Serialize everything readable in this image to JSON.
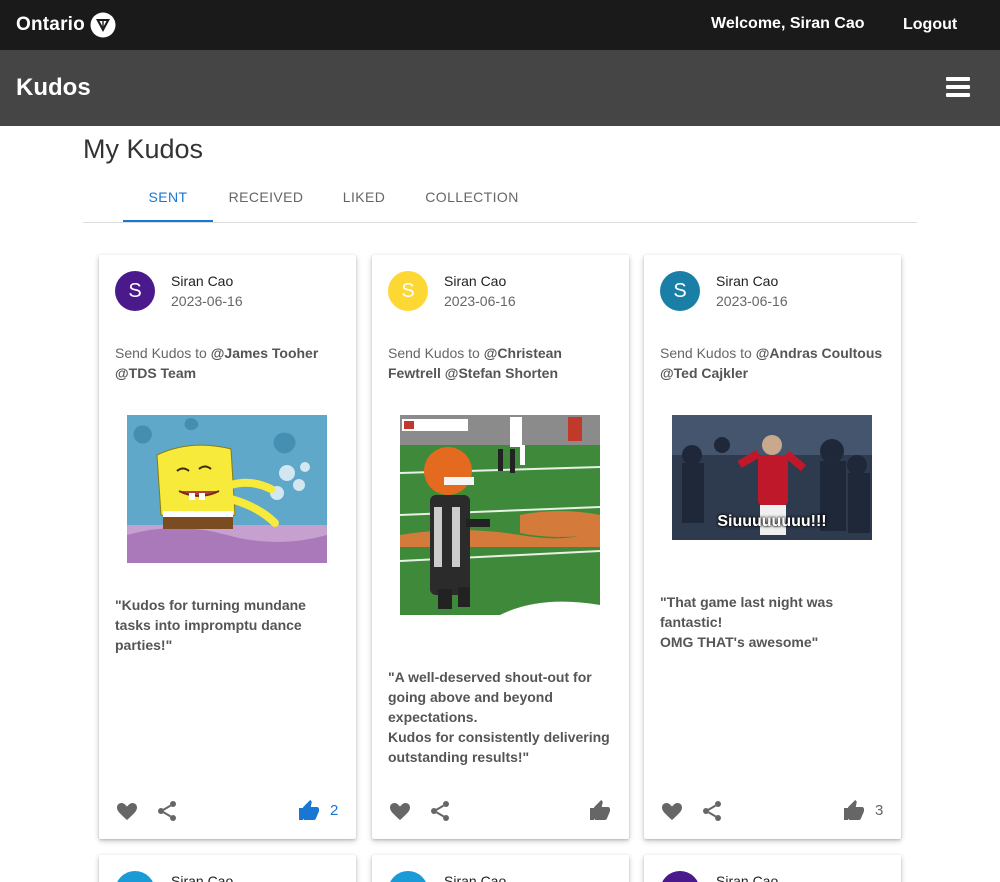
{
  "topbar": {
    "brand": "Ontario",
    "welcome": "Welcome, Siran Cao",
    "logout": "Logout"
  },
  "appbar": {
    "title": "Kudos"
  },
  "page": {
    "title": "My Kudos"
  },
  "tabs": [
    {
      "label": "SENT",
      "active": true
    },
    {
      "label": "RECEIVED",
      "active": false
    },
    {
      "label": "LIKED",
      "active": false
    },
    {
      "label": "COLLECTION",
      "active": false
    }
  ],
  "colors": {
    "accent": "#1976d2",
    "purple": "#4a1a8c",
    "yellow": "#fdd835",
    "teal": "#1a7fa6"
  },
  "cards": [
    {
      "avatar_letter": "S",
      "author": "Siran Cao",
      "date": "2023-06-16",
      "send_prefix": "Send Kudos to ",
      "recipients": "@James Tooher @TDS Team",
      "gif_caption": "",
      "message": "\"Kudos for turning mundane tasks into impromptu dance parties!\"",
      "like_count": "2",
      "liked": true
    },
    {
      "avatar_letter": "S",
      "author": "Siran Cao",
      "date": "2023-06-16",
      "send_prefix": "Send Kudos to ",
      "recipients": "@Christean Fewtrell @Stefan Shorten",
      "gif_caption": "",
      "message": "\"A well-deserved shout-out for going above and beyond expectations.\nKudos for consistently delivering outstanding results!\"",
      "like_count": "",
      "liked": false
    },
    {
      "avatar_letter": "S",
      "author": "Siran Cao",
      "date": "2023-06-16",
      "send_prefix": "Send Kudos to ",
      "recipients": "@Andras Coultous @Ted Cajkler",
      "gif_caption": "Siuuuuuuuu!!!",
      "message": "\"That game last night was fantastic!\nOMG THAT's awesome\"",
      "like_count": "3",
      "liked": false
    }
  ],
  "next_row": [
    {
      "author": "Siran Cao"
    },
    {
      "author": "Siran Cao"
    },
    {
      "author": "Siran Cao"
    }
  ]
}
